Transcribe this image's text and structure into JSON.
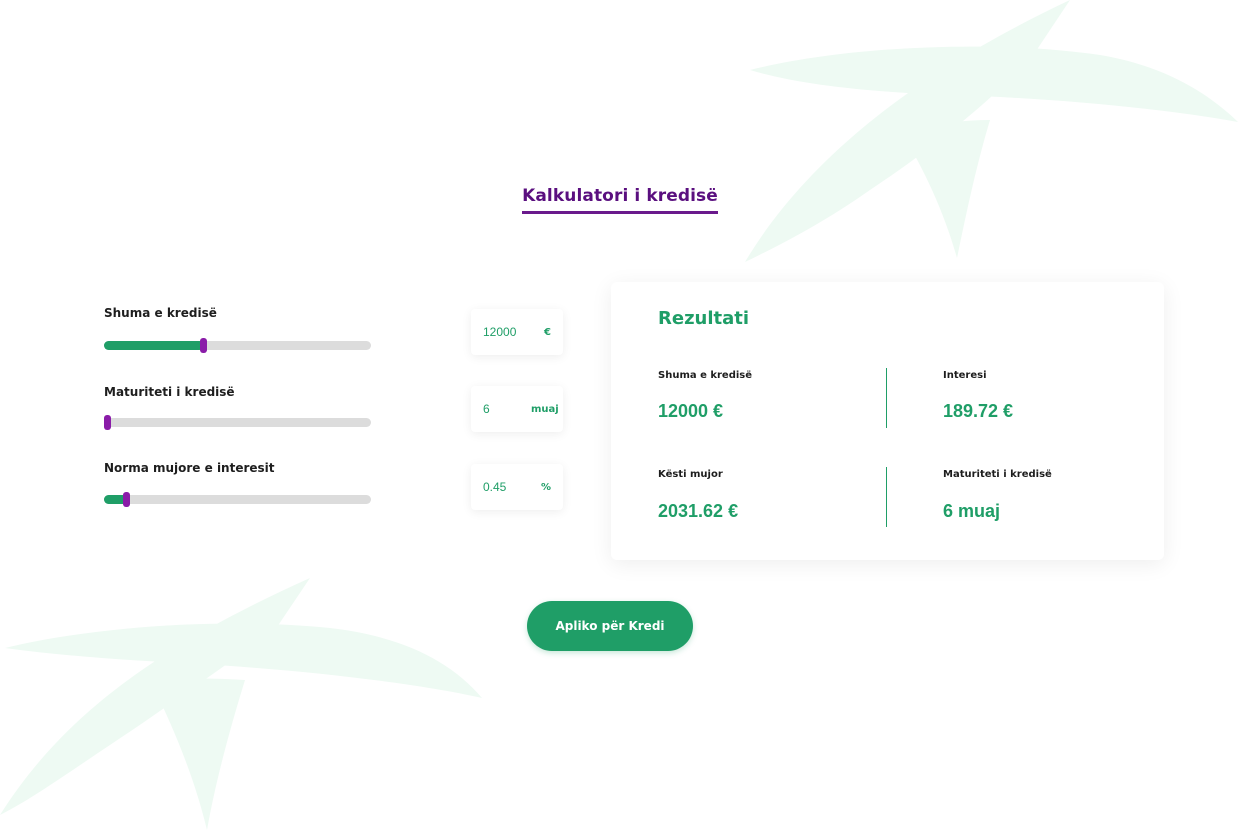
{
  "page": {
    "title": "Kalkulatori i kredisë"
  },
  "colors": {
    "brand_green": "#1f9e67",
    "brand_purple": "#6a1a8c",
    "track_gray": "#dcdcdc",
    "background_star": "#eefaf3"
  },
  "calculator": {
    "sliders": [
      {
        "label": "Shuma e kredisë",
        "value": "12000",
        "unit": "€",
        "fill_fraction": 0.375
      },
      {
        "label": "Maturiteti i kredisë",
        "value": "6",
        "unit": "muaj",
        "fill_fraction": 0.015
      },
      {
        "label": "Norma mujore e interesit",
        "value": "0.45",
        "unit": "%",
        "fill_fraction": 0.085
      }
    ]
  },
  "result": {
    "title": "Rezultati",
    "items": [
      {
        "label": "Shuma e kredisë",
        "value": "12000 €"
      },
      {
        "label": "Interesi",
        "value": "189.72 €"
      },
      {
        "label": "Kësti mujor",
        "value": "2031.62 €"
      },
      {
        "label": "Maturiteti i kredisë",
        "value": "6 muaj"
      }
    ]
  },
  "actions": {
    "apply_label": "Apliko për Kredi"
  }
}
